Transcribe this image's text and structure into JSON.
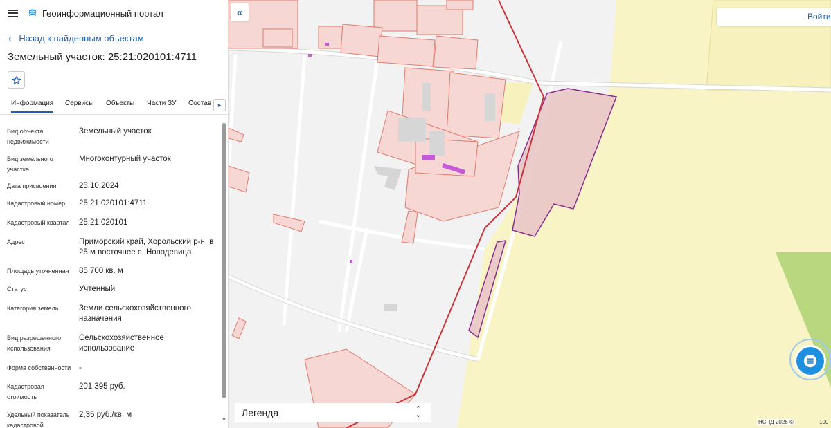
{
  "header": {
    "app_title": "Геоинформационный портал"
  },
  "back_link": "Назад к найденным объектам",
  "object_title": "Земельный участок: 25:21:020101:4711",
  "tabs": [
    {
      "label": "Информация",
      "active": true
    },
    {
      "label": "Сервисы"
    },
    {
      "label": "Объекты"
    },
    {
      "label": "Части ЗУ"
    },
    {
      "label": "Состав"
    }
  ],
  "tab_scroll_arrow": "▸",
  "properties": [
    {
      "key": "Вид объекта недвижимости",
      "value": "Земельный участок"
    },
    {
      "key": "Вид земельного участка",
      "value": "Многоконтурный участок"
    },
    {
      "key": "Дата присвоения",
      "value": "25.10.2024"
    },
    {
      "key": "Кадастровый номер",
      "value": "25:21:020101:4711"
    },
    {
      "key": "Кадастровый квартал",
      "value": "25:21:020101"
    },
    {
      "key": "Адрес",
      "value": "Приморский край, Хорольский р-н, в 25 м восточнее с. Новодевица"
    },
    {
      "key": "Площадь уточненная",
      "value": "85 700 кв. м"
    },
    {
      "key": "Статус",
      "value": "Учтенный"
    },
    {
      "key": "Категория земель",
      "value": "Земли сельскохозяйственного назначения"
    },
    {
      "key": "Вид разрешенного использования",
      "value": "Сельскохозяйственное использование"
    },
    {
      "key": "Форма собственности",
      "value": "-"
    },
    {
      "key": "Кадастровая стоимость",
      "value": "201 395 руб."
    },
    {
      "key": "Удельный показатель кадастровой",
      "value": "2,35 руб./кв. м"
    }
  ],
  "map": {
    "collapse_icon": "«",
    "login_label": "Войти",
    "legend_label": "Легенда",
    "legend_toggle_icon": "⌃⌄",
    "copyright": "НСПД 2026 ©",
    "scale_label": "100"
  },
  "colors": {
    "accent": "#1e5fb4",
    "parcel_fill": "#f6d7d3",
    "parcel_stroke": "#e27b6e",
    "selected_fill": "#e8c6c8",
    "selected_stroke": "#8a2c8c",
    "farmland": "#f8f4c6",
    "green_field": "#b9d77e",
    "boundary_line": "#c8363a"
  }
}
